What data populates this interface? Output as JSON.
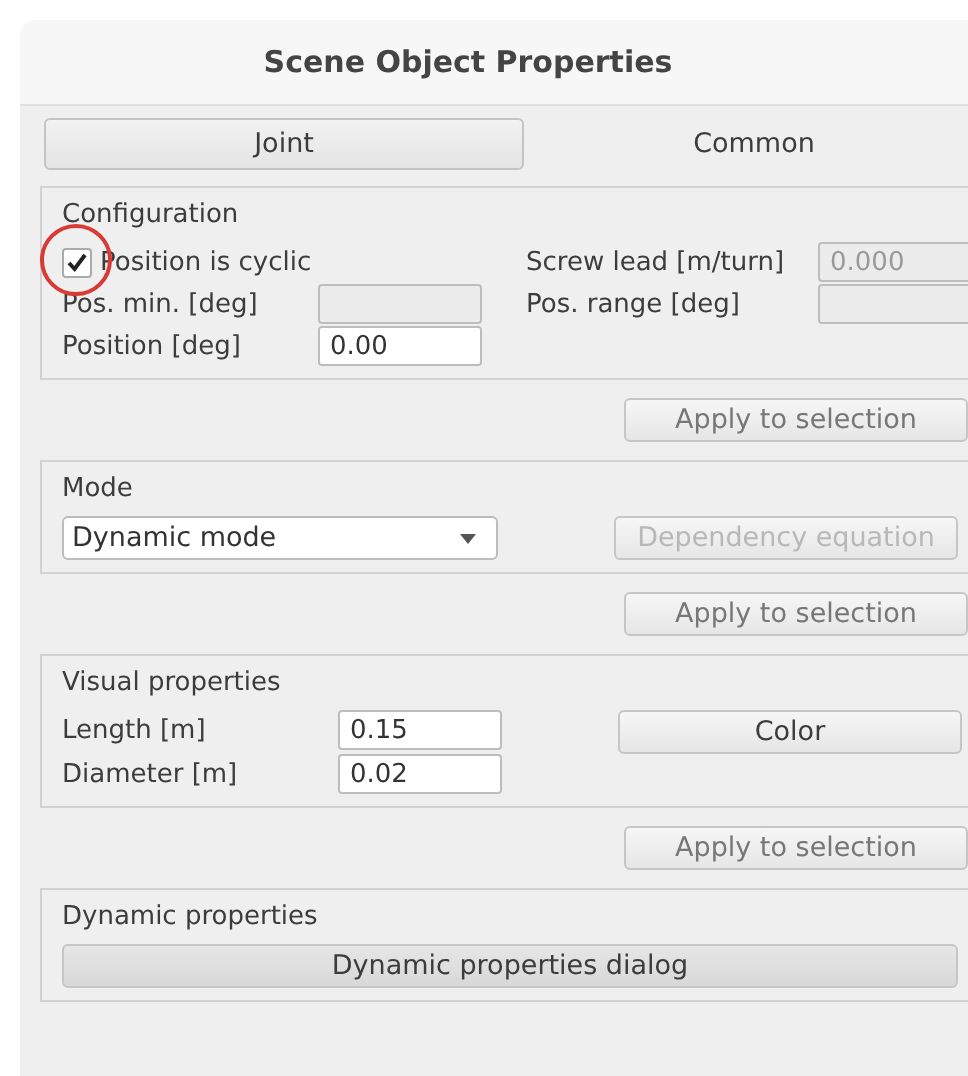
{
  "window": {
    "title": "Scene Object Properties"
  },
  "tabs": [
    {
      "label": "Joint",
      "selected": true
    },
    {
      "label": "Common",
      "selected": false
    }
  ],
  "configuration": {
    "title": "Configuration",
    "cyclic": {
      "label": "Position is cyclic",
      "checked": true,
      "highlighted": true
    },
    "fields": [
      {
        "label": "Screw lead [m/turn]",
        "value": "0.000",
        "disabled": true
      },
      {
        "label": "Pos. min. [deg]",
        "disabled": true
      },
      {
        "label": "Pos. range [deg]",
        "disabled": true
      },
      {
        "label": "Position [deg]",
        "value": "0.00",
        "disabled": false
      }
    ],
    "apply": {
      "label": "Apply to selection",
      "disabled": false
    }
  },
  "mode": {
    "title": "Mode",
    "select": {
      "value": "Dynamic mode"
    },
    "dependency": {
      "label": "Dependency equation",
      "disabled": true
    },
    "apply": {
      "label": "Apply to selection",
      "disabled": false
    }
  },
  "visual": {
    "title": "Visual properties",
    "fields": [
      {
        "label": "Length [m]",
        "value": "0.15",
        "disabled": false
      },
      {
        "label": "Diameter [m]",
        "value": "0.02",
        "disabled": false
      }
    ],
    "color": {
      "label": "Color"
    },
    "apply": {
      "label": "Apply to selection",
      "disabled": false
    }
  },
  "dynamic": {
    "title": "Dynamic properties",
    "button": {
      "label": "Dynamic properties dialog"
    }
  }
}
